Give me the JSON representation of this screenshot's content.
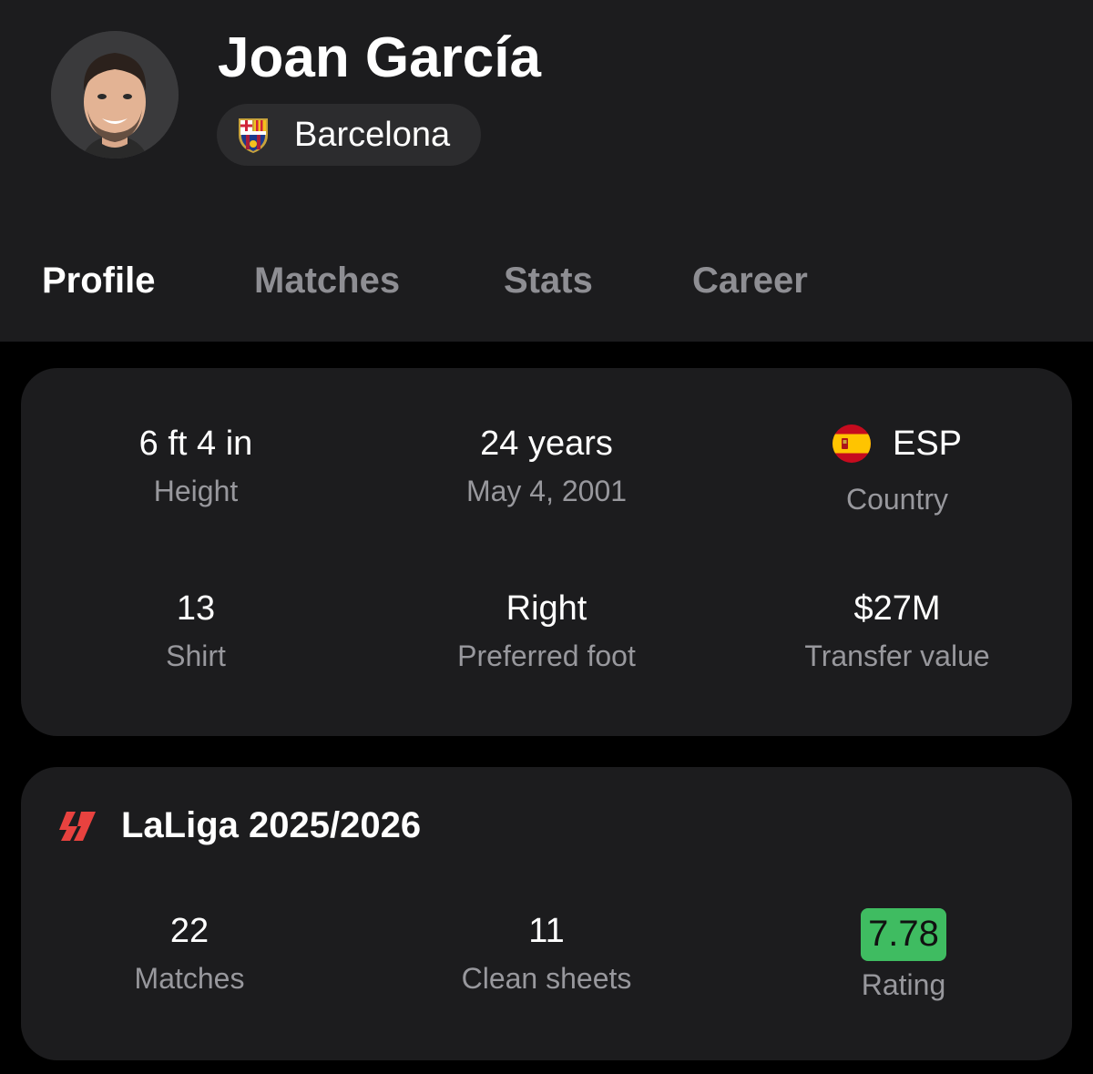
{
  "player": {
    "name": "Joan García",
    "avatar_icon": "player-photo",
    "team": {
      "name": "Barcelona",
      "crest_icon": "barcelona-crest-icon"
    }
  },
  "tabs": [
    {
      "label": "Profile",
      "active": true
    },
    {
      "label": "Matches",
      "active": false
    },
    {
      "label": "Stats",
      "active": false
    },
    {
      "label": "Career",
      "active": false
    }
  ],
  "info": {
    "height": {
      "value": "6 ft 4 in",
      "label": "Height"
    },
    "age": {
      "value": "24 years",
      "label": "May 4, 2001"
    },
    "country": {
      "value": "ESP",
      "label": "Country",
      "flag_icon": "spain-flag-icon"
    },
    "shirt": {
      "value": "13",
      "label": "Shirt"
    },
    "foot": {
      "value": "Right",
      "label": "Preferred foot"
    },
    "transfer": {
      "value": "$27M",
      "label": "Transfer value"
    }
  },
  "league": {
    "name": "LaLiga 2025/2026",
    "logo_icon": "laliga-logo-icon",
    "stats": {
      "matches": {
        "value": "22",
        "label": "Matches"
      },
      "clean_sheets": {
        "value": "11",
        "label": "Clean sheets"
      },
      "rating": {
        "value": "7.78",
        "label": "Rating",
        "color": "#3fbc61"
      }
    }
  },
  "colors": {
    "background": "#000000",
    "surface": "#1c1c1e",
    "pill": "#2c2c2e",
    "secondary_text": "#98989d",
    "inactive_tab": "#8e8e93",
    "accent_red": "#e8423f"
  }
}
